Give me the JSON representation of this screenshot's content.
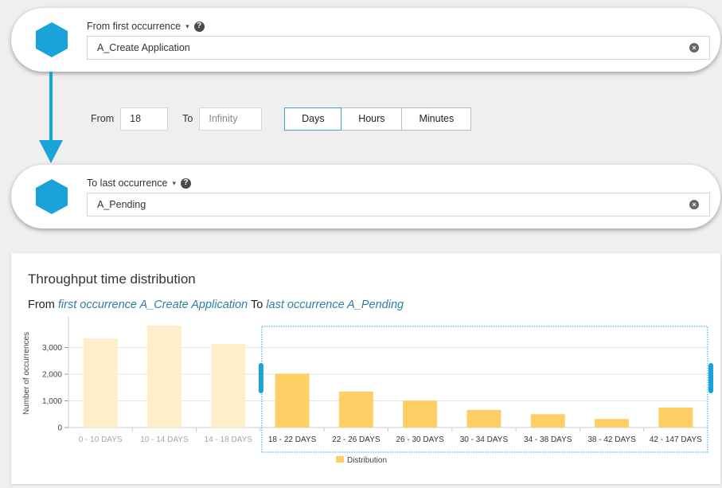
{
  "from_selector": {
    "label": "From first occurrence",
    "caret": "▾",
    "help": "?",
    "value": "A_Create Application",
    "clear": "×"
  },
  "to_selector": {
    "label": "To last occurrence",
    "caret": "▾",
    "help": "?",
    "value": "A_Pending",
    "clear": "×"
  },
  "range": {
    "from_label": "From",
    "from_value": "18",
    "to_label": "To",
    "to_placeholder": "Infinity",
    "units": [
      "Days",
      "Hours",
      "Minutes"
    ],
    "active_unit": "Days"
  },
  "colors": {
    "accent": "#1aa3d9",
    "bar_selected": "#fcd065",
    "bar_unselected": "#fdefca",
    "link": "#2e7fa5"
  },
  "panel": {
    "title": "Throughput time distribution",
    "sub_from": "From",
    "sub_first": "first occurrence A_Create Application",
    "sub_to": "To",
    "sub_last": "last occurrence A_Pending"
  },
  "chart_data": {
    "type": "bar",
    "ylabel": "Number of occurrences",
    "categories": [
      "0 - 10 DAYS",
      "10 - 14 DAYS",
      "14 - 18 DAYS",
      "18 - 22 DAYS",
      "22 - 26 DAYS",
      "26 - 30 DAYS",
      "30 - 34 DAYS",
      "34 - 38 DAYS",
      "38 - 42 DAYS",
      "42 - 147 DAYS"
    ],
    "values": [
      3340,
      3820,
      3130,
      2020,
      1350,
      1010,
      660,
      500,
      320,
      750
    ],
    "selected": [
      false,
      false,
      false,
      true,
      true,
      true,
      true,
      true,
      true,
      true
    ],
    "yticks": [
      0,
      1000,
      2000,
      3000
    ],
    "ytick_labels": [
      "0",
      "1,000",
      "2,000",
      "3,000"
    ],
    "ylim": [
      0,
      4000
    ],
    "legend": "Distribution",
    "legend_placement": "bottom-center"
  }
}
